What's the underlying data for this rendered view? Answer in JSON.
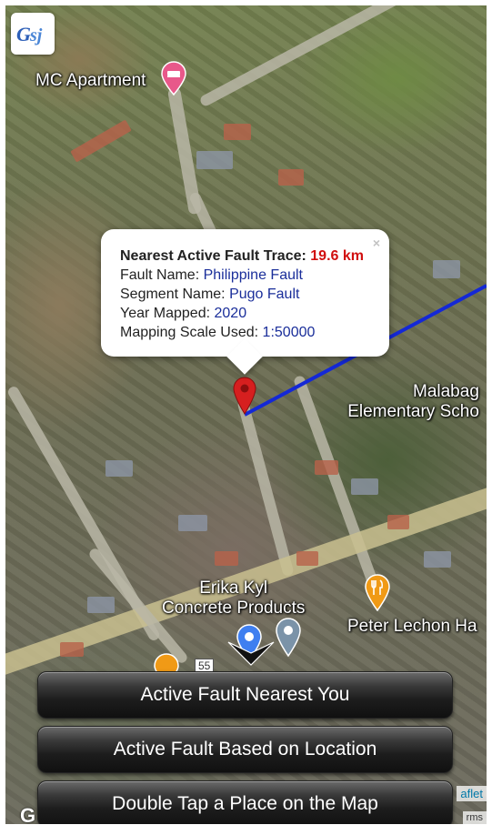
{
  "map": {
    "places": {
      "mc_apartment": "MC Apartment",
      "malabag_line1": "Malabag",
      "malabag_line2": "Elementary Scho",
      "erika_line1": "Erika Kyl",
      "erika_line2": "Concrete Products",
      "peter_lechon": "Peter Lechon Ha",
      "road_number": "55"
    },
    "google_mark": "G",
    "attribution": {
      "leaflet": "aflet",
      "terms": "rms"
    },
    "colors": {
      "fault_line": "#1428d6",
      "marker": "#d61f1f"
    }
  },
  "popup": {
    "nearest_label": "Nearest Active Fault Trace:",
    "nearest_value": "19.6 km",
    "fault_name_label": "Fault Name:",
    "fault_name_value": "Philippine Fault",
    "segment_label": "Segment Name:",
    "segment_value": "Pugo Fault",
    "year_label": "Year Mapped:",
    "year_value": "2020",
    "scale_label": "Mapping Scale Used:",
    "scale_value": "1:50000",
    "close": "×"
  },
  "buttons": {
    "nearest": "Active Fault Nearest You",
    "location": "Active Fault Based on Location",
    "double_tap": "Double Tap a Place on the Map"
  }
}
